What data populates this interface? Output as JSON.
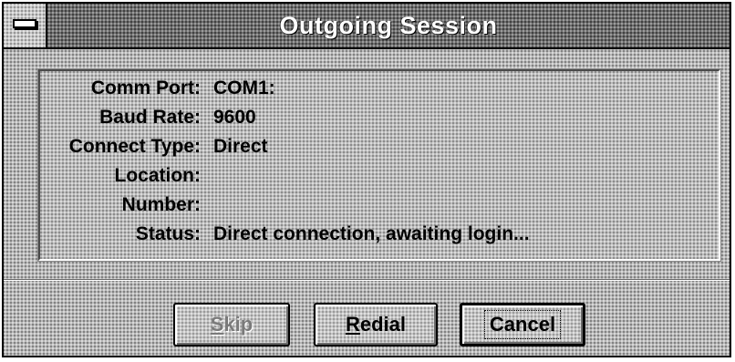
{
  "window": {
    "title": "Outgoing Session",
    "system_menu_icon": "system-menu-icon"
  },
  "session_info": [
    {
      "label": "Comm Port:",
      "value": "COM1:"
    },
    {
      "label": "Baud Rate:",
      "value": "9600"
    },
    {
      "label": "Connect Type:",
      "value": "Direct"
    },
    {
      "label": "Location:",
      "value": ""
    },
    {
      "label": "Number:",
      "value": ""
    },
    {
      "label": "Status:",
      "value": "Direct connection, awaiting login..."
    }
  ],
  "buttons": {
    "skip": {
      "mnemonic": "S",
      "rest": "kip",
      "enabled": false
    },
    "redial": {
      "mnemonic": "R",
      "rest": "edial",
      "enabled": true
    },
    "cancel": {
      "label": "Cancel",
      "enabled": true,
      "default": true
    }
  }
}
